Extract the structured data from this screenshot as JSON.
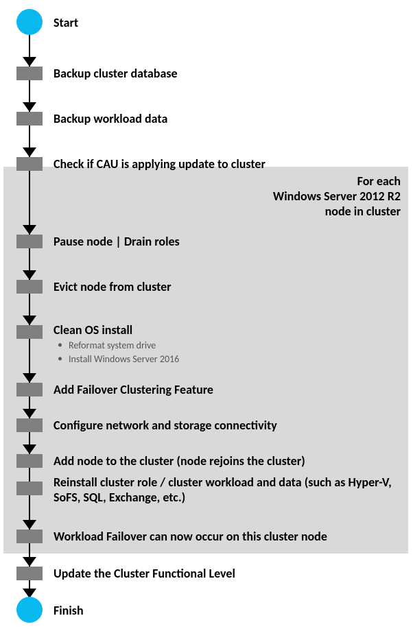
{
  "chart_data": {
    "type": "flowchart",
    "title": "",
    "loop_label_lines": [
      "For each",
      "Windows Server 2012 R2",
      "node in cluster"
    ],
    "nodes": [
      {
        "id": "start",
        "kind": "terminator",
        "label": "Start"
      },
      {
        "id": "s1",
        "kind": "process",
        "label": "Backup cluster database"
      },
      {
        "id": "s2",
        "kind": "process",
        "label": "Backup workload data"
      },
      {
        "id": "s3",
        "kind": "process",
        "label": "Check if CAU is applying update to cluster"
      },
      {
        "id": "l1",
        "kind": "process",
        "label": "Pause node | Drain roles",
        "in_loop": true
      },
      {
        "id": "l2",
        "kind": "process",
        "label": "Evict node from cluster",
        "in_loop": true
      },
      {
        "id": "l3",
        "kind": "process",
        "label": "Clean OS install",
        "in_loop": true,
        "sub": [
          "Reformat system drive",
          "Install Windows Server 2016"
        ]
      },
      {
        "id": "l4",
        "kind": "process",
        "label": "Add Failover Clustering Feature",
        "in_loop": true
      },
      {
        "id": "l5",
        "kind": "process",
        "label": "Configure network and storage connectivity",
        "in_loop": true
      },
      {
        "id": "l6",
        "kind": "process",
        "label": "Add node to the cluster (node rejoins the cluster)",
        "in_loop": true
      },
      {
        "id": "l7",
        "kind": "process",
        "label": "Reinstall cluster role / cluster workload and data (such as Hyper-V, SoFS, SQL, Exchange, etc.)",
        "in_loop": true
      },
      {
        "id": "l8",
        "kind": "process",
        "label": "Workload Failover can now occur on this cluster node",
        "in_loop": true
      },
      {
        "id": "s4",
        "kind": "process",
        "label": "Update the Cluster Functional Level"
      },
      {
        "id": "finish",
        "kind": "terminator",
        "label": "Finish"
      }
    ]
  }
}
